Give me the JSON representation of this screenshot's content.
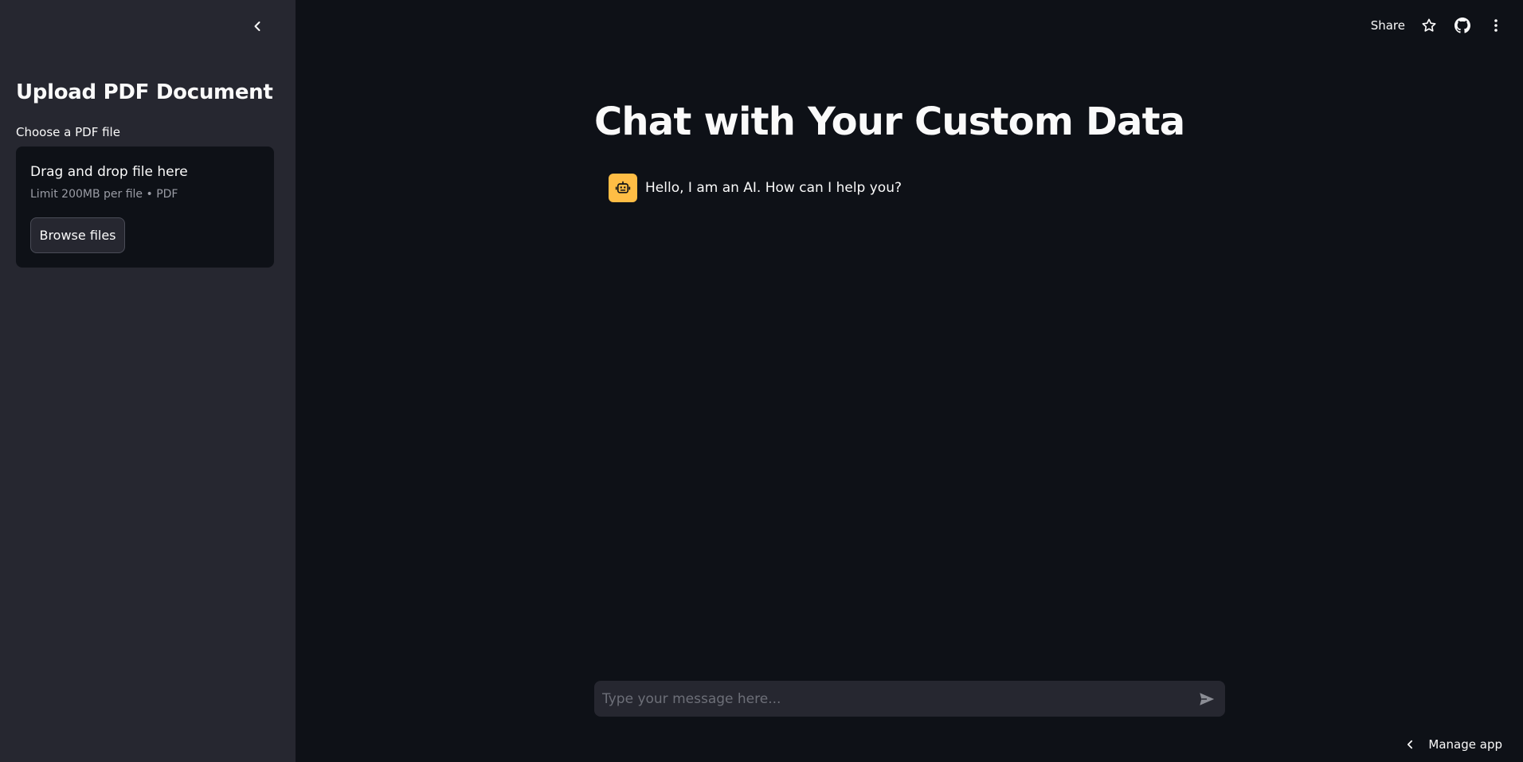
{
  "sidebar": {
    "collapse_icon": "chevron-left-icon",
    "title": "Upload PDF Document",
    "uploader": {
      "label": "Choose a PDF file",
      "dropzone_title": "Drag and drop file here",
      "dropzone_limit": "Limit 200MB per file • PDF",
      "browse_label": "Browse files"
    }
  },
  "toolbar": {
    "share_label": "Share",
    "icons": [
      "star-icon",
      "github-icon",
      "more-vertical-icon"
    ]
  },
  "main": {
    "title": "Chat with Your Custom Data",
    "messages": [
      {
        "role": "assistant",
        "avatar_icon": "robot-icon",
        "text": "Hello, I am an AI. How can I help you?"
      }
    ],
    "chat_input": {
      "placeholder": "Type your message here...",
      "value": "",
      "send_icon": "send-icon"
    }
  },
  "footer": {
    "manage_label": "Manage app",
    "manage_icon": "chevron-left-icon"
  },
  "colors": {
    "background": "#0e1117",
    "sidebar": "#262730",
    "avatar": "#ffbd45",
    "text": "#fafafa",
    "muted": "#9a9ca5"
  }
}
